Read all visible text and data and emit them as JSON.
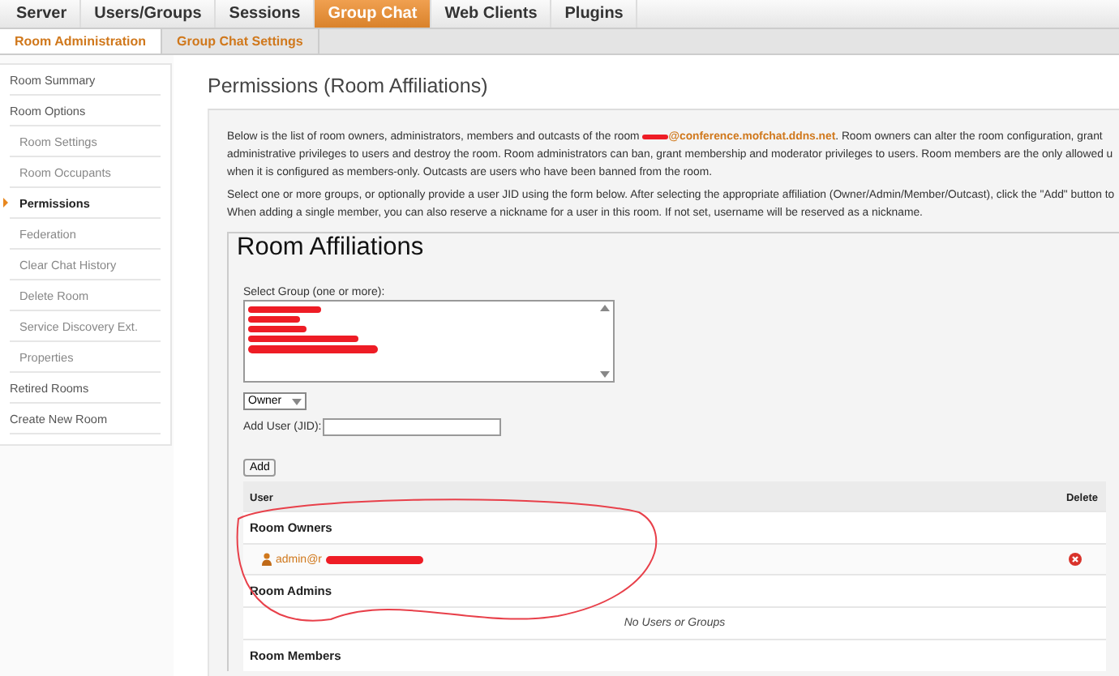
{
  "top_tabs": [
    {
      "label": "Server",
      "selected": false
    },
    {
      "label": "Users/Groups",
      "selected": false
    },
    {
      "label": "Sessions",
      "selected": false
    },
    {
      "label": "Group Chat",
      "selected": true
    },
    {
      "label": "Web Clients",
      "selected": false
    },
    {
      "label": "Plugins",
      "selected": false
    }
  ],
  "sub_tabs": [
    {
      "label": "Room Administration",
      "selected": true
    },
    {
      "label": "Group Chat Settings",
      "selected": false
    }
  ],
  "sidebar": {
    "items": [
      {
        "label": "Room Summary",
        "selected": false
      },
      {
        "label": "Room Options",
        "selected": false,
        "children": [
          {
            "label": "Room Settings",
            "selected": false
          },
          {
            "label": "Room Occupants",
            "selected": false
          },
          {
            "label": "Permissions",
            "selected": true
          },
          {
            "label": "Federation",
            "selected": false
          },
          {
            "label": "Clear Chat History",
            "selected": false
          },
          {
            "label": "Delete Room",
            "selected": false
          },
          {
            "label": "Service Discovery Ext.",
            "selected": false
          },
          {
            "label": "Properties",
            "selected": false
          }
        ]
      },
      {
        "label": "Retired Rooms",
        "selected": false
      },
      {
        "label": "Create New Room",
        "selected": false
      }
    ]
  },
  "page_title": "Permissions (Room Affiliations)",
  "intro": {
    "first_line": {
      "before": "Below is the list of room owners, administrators, members and outcasts of the room",
      "room_jid": "@conference.mofchat.ddns.net",
      "after": ". Room owners can alter the room configuration, grant"
    },
    "more_lines": [
      "administrative privileges to users and destroy the room. Room administrators can ban, grant membership and moderator privileges to users. Room members are the only allowed u",
      "when it is configured as members-only. Outcasts are users who have been banned from the room."
    ]
  },
  "instructions": [
    "Select one or more groups, or optionally provide a user JID using the form below. After selecting the appropriate affiliation (Owner/Admin/Member/Outcast), click the \"Add\" button to",
    "When adding a single member, you can also reserve a nickname for a user in this room. If not set, username will be reserved as a nickname."
  ],
  "form": {
    "legend": "Room Affiliations",
    "group_label": "Select Group (one or more):",
    "affiliation": "Owner",
    "jid_label": "Add User (JID):",
    "add_button": "Add"
  },
  "table": {
    "columns": [
      "User",
      "Delete"
    ],
    "sections": [
      {
        "title": "Room Owners",
        "rows": [
          {
            "kind": "user",
            "label": "admin@r"
          }
        ]
      },
      {
        "title": "Room Admins",
        "rows": [
          {
            "kind": "empty",
            "label": "No Users or Groups"
          }
        ]
      },
      {
        "title": "Room Members"
      }
    ]
  }
}
